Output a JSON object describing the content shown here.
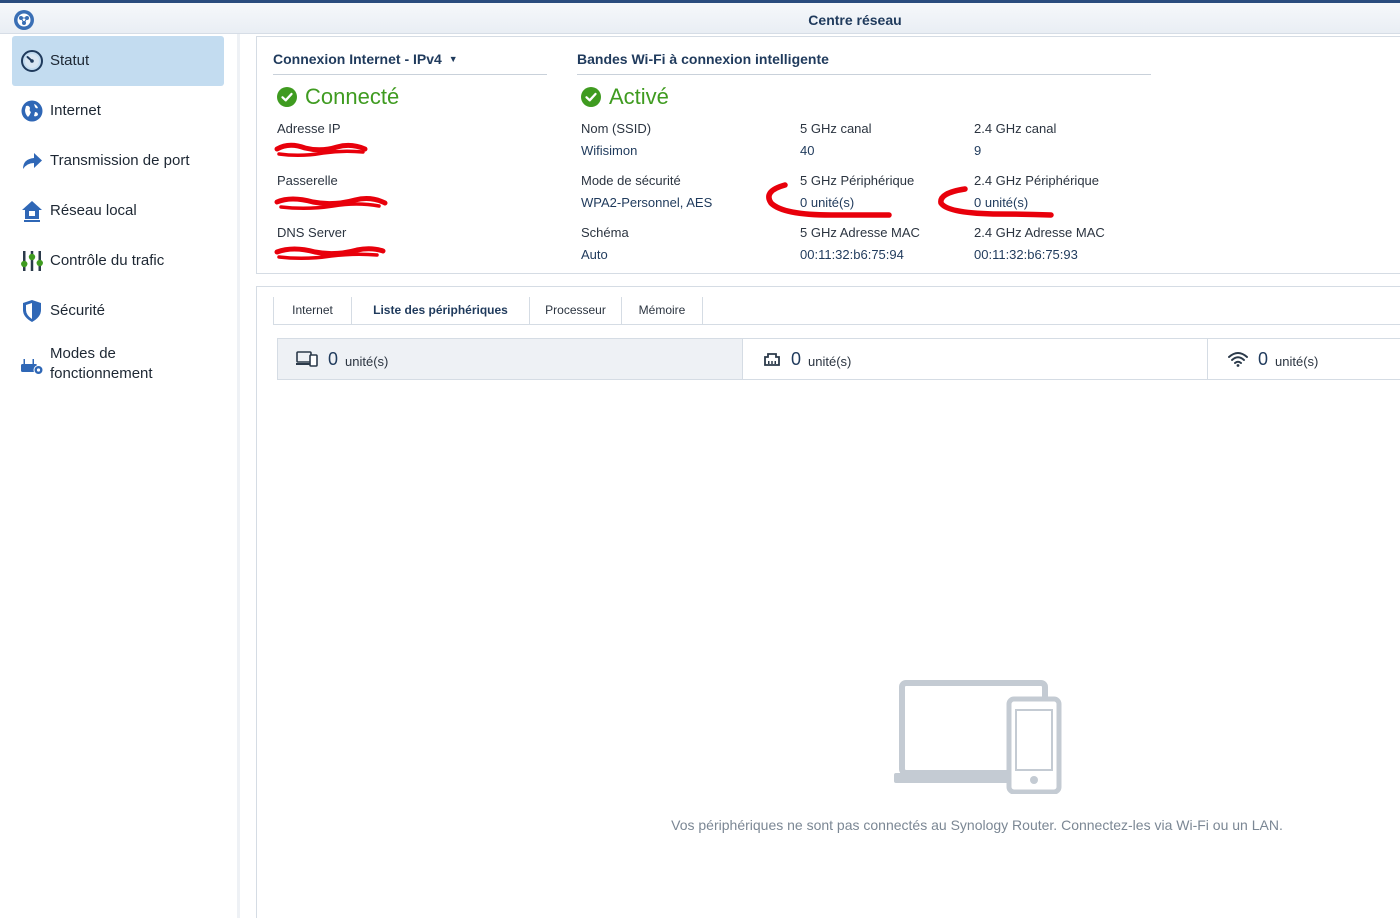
{
  "window": {
    "title": "Centre réseau"
  },
  "sidebar": {
    "items": [
      {
        "label": "Statut",
        "icon": "gauge-icon"
      },
      {
        "label": "Internet",
        "icon": "globe-icon"
      },
      {
        "label": "Transmission de port",
        "icon": "forward-arrow-icon"
      },
      {
        "label": "Réseau local",
        "icon": "home-network-icon"
      },
      {
        "label": "Contrôle du trafic",
        "icon": "sliders-icon"
      },
      {
        "label": "Sécurité",
        "icon": "shield-icon"
      },
      {
        "label": "Modes de fonctionnement",
        "icon": "router-gear-icon"
      }
    ]
  },
  "internet": {
    "heading": "Connexion Internet - IPv4",
    "status": "Connecté",
    "ip_label": "Adresse IP",
    "ip_value": "",
    "gateway_label": "Passerelle",
    "gateway_value": "",
    "dns_label": "DNS Server",
    "dns_value": ""
  },
  "wifi": {
    "heading": "Bandes Wi-Fi à connexion intelligente",
    "status": "Activé",
    "ssid_label": "Nom (SSID)",
    "ssid_value": "Wifisimon",
    "ch5_label": "5 GHz canal",
    "ch5_value": "40",
    "ch24_label": "2.4 GHz canal",
    "ch24_value": "9",
    "security_label": "Mode de sécurité",
    "security_value": "WPA2-Personnel, AES",
    "dev5_label": "5 GHz Périphérique",
    "dev5_value": "0 unité(s)",
    "dev24_label": "2.4 GHz Périphérique",
    "dev24_value": "0 unité(s)",
    "schema_label": "Schéma",
    "schema_value": "Auto",
    "mac5_label": "5 GHz Adresse MAC",
    "mac5_value": "00:11:32:b6:75:94",
    "mac24_label": "2.4 GHz Adresse MAC",
    "mac24_value": "00:11:32:b6:75:93"
  },
  "tabs": [
    "Internet",
    "Liste des périphériques",
    "Processeur",
    "Mémoire"
  ],
  "active_tab": "Liste des périphériques",
  "summary": [
    {
      "icon": "devices-icon",
      "count": "0",
      "unit": "unité(s)"
    },
    {
      "icon": "lan-port-icon",
      "count": "0",
      "unit": "unité(s)"
    },
    {
      "icon": "wifi-icon",
      "count": "0",
      "unit": "unité(s)"
    }
  ],
  "empty_state": {
    "icon": "laptop-phone-icon",
    "message": "Vos périphériques ne sont pas connectés au Synology Router. Connectez-les via Wi-Fi ou un LAN."
  },
  "colors": {
    "accent": "#1f3a5c",
    "success": "#3f9b20",
    "selected": "#c3dcf0",
    "annotation": "#e8000b"
  }
}
